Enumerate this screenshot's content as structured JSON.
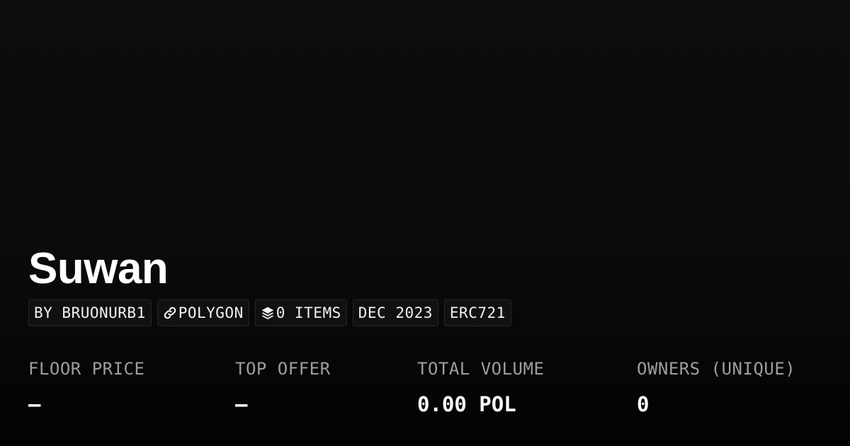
{
  "collection": {
    "name": "Suwan"
  },
  "tags": {
    "creator": "BY BRUONURB1",
    "chain": "POLYGON",
    "chain_icon": "link-icon",
    "items": "0 ITEMS",
    "items_icon": "layers-icon",
    "date": "DEC 2023",
    "standard": "ERC721"
  },
  "stats": [
    {
      "label": "FLOOR PRICE",
      "value": "–"
    },
    {
      "label": "TOP OFFER",
      "value": "–"
    },
    {
      "label": "TOTAL VOLUME",
      "value": "0.00 POL"
    },
    {
      "label": "OWNERS (UNIQUE)",
      "value": "0"
    }
  ],
  "colors": {
    "background": "#0b0b0b",
    "title": "#ffffff",
    "label": "#9e9e9e",
    "tag_background": "#111111",
    "tag_border": "#262626"
  }
}
